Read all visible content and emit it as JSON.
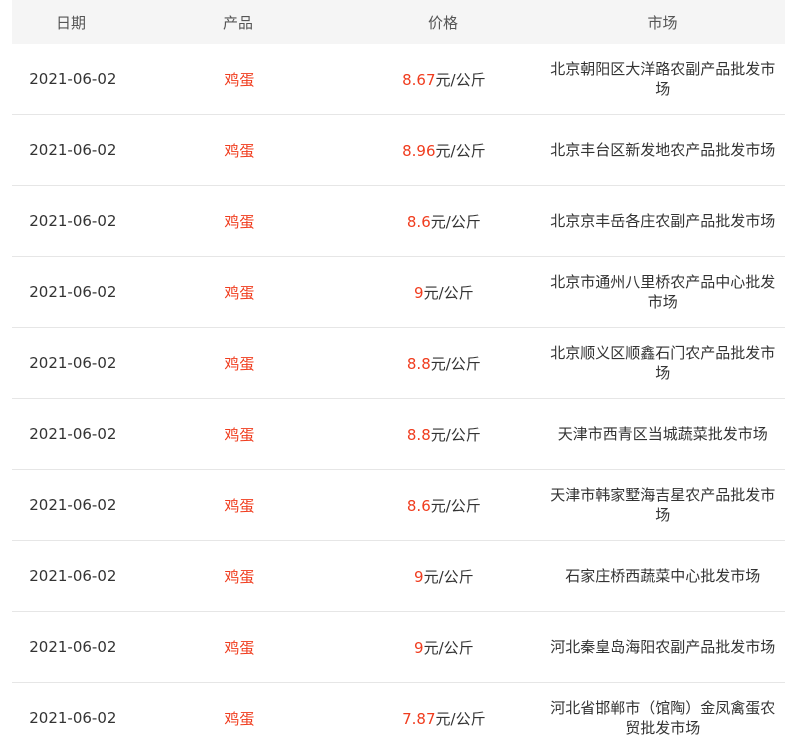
{
  "header": {
    "date": "日期",
    "product": "产品",
    "price": "价格",
    "market": "市场"
  },
  "unit": "元/公斤",
  "rows": [
    {
      "date": "2021-06-02",
      "product": "鸡蛋",
      "price": "8.67",
      "market": "北京朝阳区大洋路农副产品批发市场"
    },
    {
      "date": "2021-06-02",
      "product": "鸡蛋",
      "price": "8.96",
      "market": "北京丰台区新发地农产品批发市场"
    },
    {
      "date": "2021-06-02",
      "product": "鸡蛋",
      "price": "8.6",
      "market": "北京京丰岳各庄农副产品批发市场"
    },
    {
      "date": "2021-06-02",
      "product": "鸡蛋",
      "price": "9",
      "market": "北京市通州八里桥农产品中心批发市场"
    },
    {
      "date": "2021-06-02",
      "product": "鸡蛋",
      "price": "8.8",
      "market": "北京顺义区顺鑫石门农产品批发市场"
    },
    {
      "date": "2021-06-02",
      "product": "鸡蛋",
      "price": "8.8",
      "market": "天津市西青区当城蔬菜批发市场"
    },
    {
      "date": "2021-06-02",
      "product": "鸡蛋",
      "price": "8.6",
      "market": "天津市韩家墅海吉星农产品批发市场"
    },
    {
      "date": "2021-06-02",
      "product": "鸡蛋",
      "price": "9",
      "market": "石家庄桥西蔬菜中心批发市场"
    },
    {
      "date": "2021-06-02",
      "product": "鸡蛋",
      "price": "9",
      "market": "河北秦皇岛海阳农副产品批发市场"
    },
    {
      "date": "2021-06-02",
      "product": "鸡蛋",
      "price": "7.87",
      "market": "河北省邯郸市（馆陶）金凤禽蛋农贸批发市场"
    }
  ],
  "colors": {
    "accent": "#f03c1e",
    "header_bg": "#f5f5f5"
  }
}
